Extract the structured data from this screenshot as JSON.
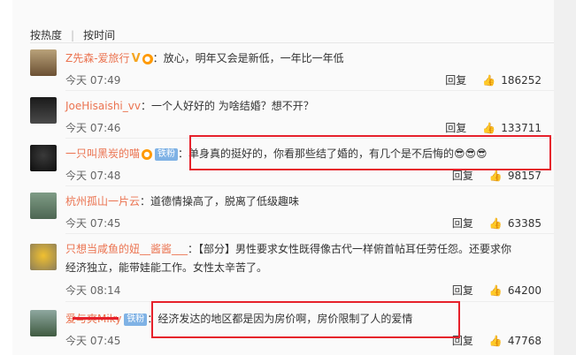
{
  "sort": {
    "hot": "按热度",
    "time": "按时间"
  },
  "comments": [
    {
      "user": "Z先森-爱旅行",
      "text": "：放心，明年又会是新低，一年比一年低",
      "time": "今天 07:49",
      "reply": "回复",
      "likes": "186252"
    },
    {
      "user": "JoeHisaishi_vv",
      "text": "：一个人好好的 为啥结婚？想不开？",
      "time": "今天 07:46",
      "reply": "回复",
      "likes": "133711"
    },
    {
      "user": "一只叫黑炭的喵",
      "badge": "铁粉",
      "text": "：单身真的挺好的，你看那些结了婚的，有几个是不后悔的😎😎😎",
      "time": "今天 07:48",
      "reply": "回复",
      "likes": "98157"
    },
    {
      "user": "杭州孤山一片云",
      "text": "：道德情操高了，脱离了低级趣味",
      "time": "今天 07:45",
      "reply": "回复",
      "likes": "63385"
    },
    {
      "user": "只想当咸鱼的妞__酱酱___",
      "text": "：【部分】男性要求女性既得像古代一样俯首帖耳任劳任怨。还要求你",
      "text2": "经济独立，能带娃能工作。女性太辛苦了。",
      "time": "今天 08:14",
      "reply": "回复",
      "likes": "64200"
    },
    {
      "user": "爱与爽Miky",
      "badge": "铁粉",
      "text": "：经济发达的地区都是因为房价啊，房价限制了人的爱情",
      "time": "今天 07:45",
      "reply": "回复",
      "likes": "47768"
    }
  ],
  "colors": {
    "username": "#eb7350",
    "highlight": "#e6212b"
  }
}
